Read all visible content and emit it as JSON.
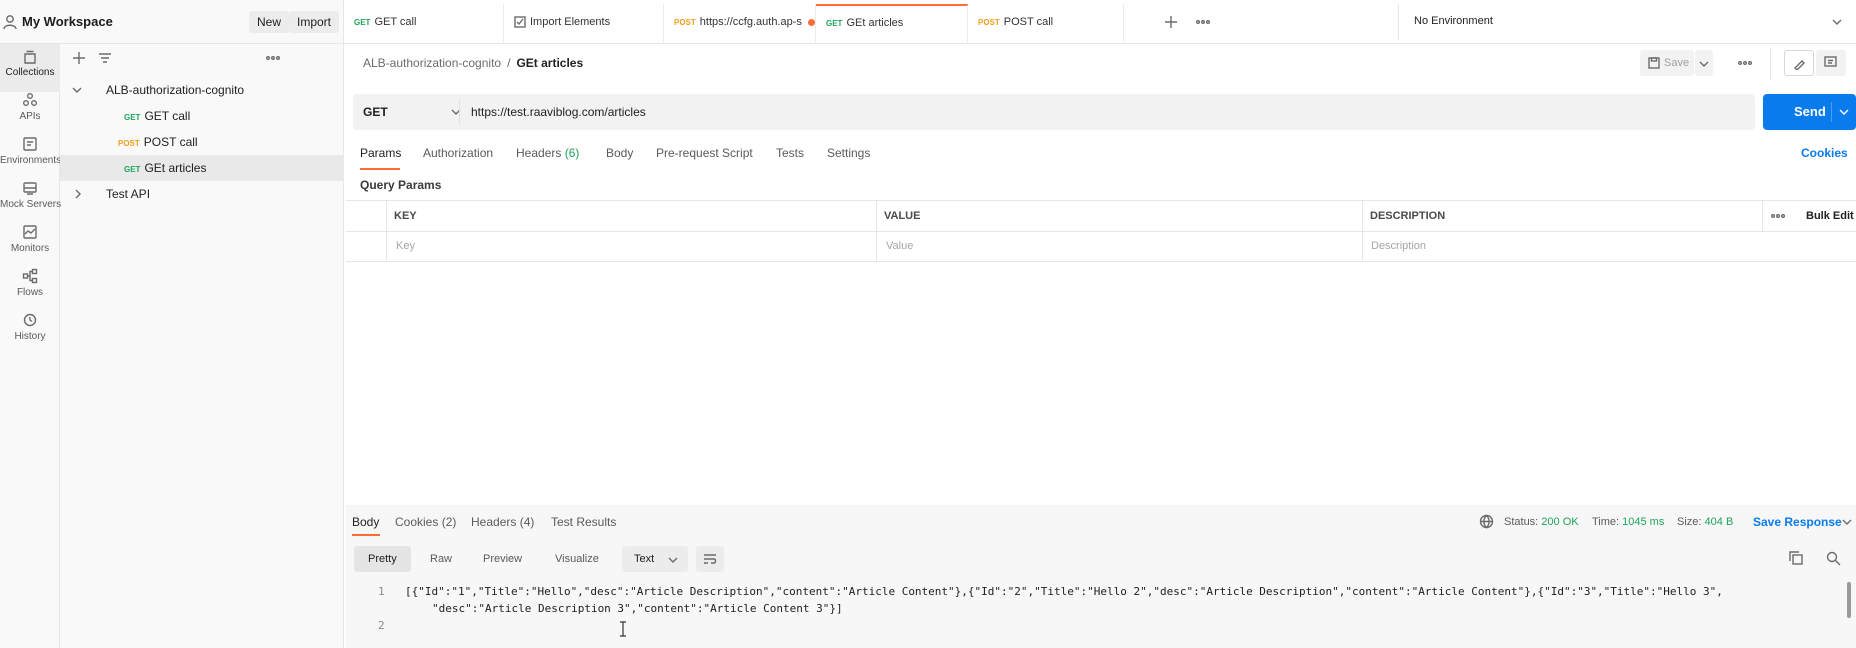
{
  "workspace": {
    "title": "My Workspace",
    "new_label": "New",
    "import_label": "Import"
  },
  "rail": {
    "items": [
      {
        "label": "Collections",
        "icon": "collections-icon",
        "active": true
      },
      {
        "label": "APIs",
        "icon": "apis-icon"
      },
      {
        "label": "Environments",
        "icon": "environments-icon"
      },
      {
        "label": "Mock Servers",
        "icon": "mock-servers-icon"
      },
      {
        "label": "Monitors",
        "icon": "monitors-icon"
      },
      {
        "label": "Flows",
        "icon": "flows-icon"
      },
      {
        "label": "History",
        "icon": "history-icon"
      }
    ]
  },
  "tree": {
    "collections": [
      {
        "name": "ALB-authorization-cognito",
        "expanded": true,
        "requests": [
          {
            "method": "GET",
            "name": "GET call"
          },
          {
            "method": "POST",
            "name": "POST call"
          },
          {
            "method": "GET",
            "name": "GEt articles",
            "active": true
          }
        ]
      },
      {
        "name": "Test API",
        "expanded": false
      }
    ]
  },
  "tabs": [
    {
      "method": "GET",
      "name": "GET call"
    },
    {
      "method": "",
      "name": "Import Elements"
    },
    {
      "method": "POST",
      "name": "https://ccfg.auth.ap-s"
    },
    {
      "method": "GET",
      "name": "GEt articles",
      "active": true
    },
    {
      "method": "POST",
      "name": "POST call"
    }
  ],
  "environment": {
    "selected": "No Environment"
  },
  "breadcrumb": {
    "parent": "ALB-authorization-cognito",
    "separator": "/",
    "current": "GEt articles"
  },
  "toolbar": {
    "save_label": "Save"
  },
  "request": {
    "method": "GET",
    "url": "https://test.raaviblog.com/articles",
    "send_label": "Send",
    "tabs": [
      "Params",
      "Authorization",
      "Headers",
      "Body",
      "Pre-request Script",
      "Tests",
      "Settings"
    ],
    "headers_count": "(6)",
    "cookies_label": "Cookies",
    "query_params_label": "Query Params",
    "table": {
      "headers": [
        "KEY",
        "VALUE",
        "DESCRIPTION"
      ],
      "placeholders": [
        "Key",
        "Value",
        "Description"
      ],
      "bulk_edit_label": "Bulk Edit"
    }
  },
  "response": {
    "tabs": [
      "Body",
      "Cookies",
      "Headers",
      "Test Results"
    ],
    "cookies_count": "(2)",
    "headers_count": "(4)",
    "status_label": "Status:",
    "status_value": "200 OK",
    "time_label": "Time:",
    "time_value": "1045 ms",
    "size_label": "Size:",
    "size_value": "404 B",
    "save_response_label": "Save Response",
    "modes": [
      "Pretty",
      "Raw",
      "Preview",
      "Visualize"
    ],
    "format": "Text",
    "lines": {
      "no1": "1",
      "line1": "[{\"Id\":\"1\",\"Title\":\"Hello\",\"desc\":\"Article Description\",\"content\":\"Article Content\"},{\"Id\":\"2\",\"Title\":\"Hello 2\",\"desc\":\"Article Description\",\"content\":\"Article Content\"},{\"Id\":\"3\",\"Title\":\"Hello 3\",",
      "line1_wrap": "\"desc\":\"Article Description 3\",\"content\":\"Article Content 3\"}]",
      "no2": "2"
    }
  },
  "colors": {
    "accent": "#ff6c37",
    "send": "#097bed",
    "get": "#20a35a",
    "post": "#f0a020"
  }
}
